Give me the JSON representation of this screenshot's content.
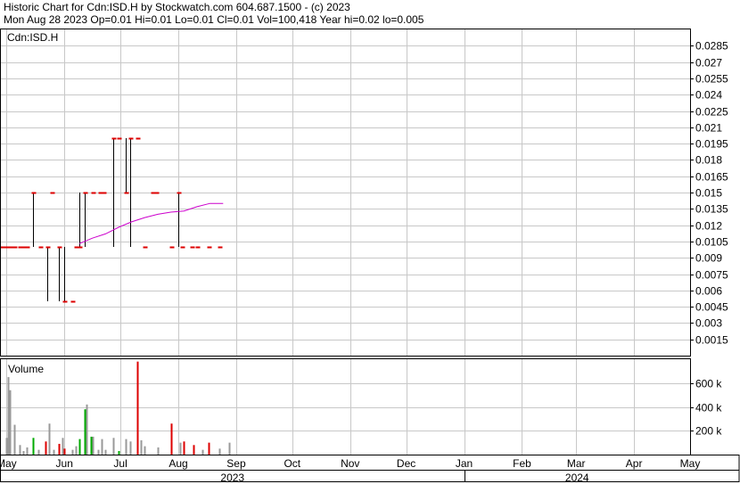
{
  "header": {
    "line1": "Historic Chart for Cdn:ISD.H by Stockwatch.com 604.687.1500 - (c) 2023",
    "line2": "Mon Aug 28 2023  Op=0.01  Hi=0.01  Lo=0.01  Cl=0.01  Vol=100,418  Year hi=0.02  lo=0.005"
  },
  "chart_data": [
    {
      "type": "ohlc",
      "label": "Cdn:ISD.H",
      "price_axis_labels": [
        "0.0285",
        "0.027",
        "0.0255",
        "0.024",
        "0.0225",
        "0.021",
        "0.0195",
        "0.018",
        "0.0165",
        "0.015",
        "0.0135",
        "0.012",
        "0.0105",
        "0.009",
        "0.0075",
        "0.006",
        "0.0045",
        "0.003",
        "0.0015"
      ],
      "ylim": [
        0,
        0.03
      ],
      "grid": true,
      "colors": {
        "bar": "#000000",
        "close_tick": "#dd0000",
        "moving_average": "#cc00cc",
        "grid": "#c8c8c8"
      },
      "bars": [
        {
          "date": "2023-05-01",
          "high": 0.01,
          "low": 0.01,
          "close": 0.01
        },
        {
          "date": "2023-05-03",
          "high": 0.01,
          "low": 0.01,
          "close": 0.01
        },
        {
          "date": "2023-05-05",
          "high": 0.01,
          "low": 0.01,
          "close": 0.01
        },
        {
          "date": "2023-05-08",
          "high": 0.01,
          "low": 0.01,
          "close": 0.01
        },
        {
          "date": "2023-05-10",
          "high": 0.01,
          "low": 0.01,
          "close": 0.01
        },
        {
          "date": "2023-05-12",
          "high": 0.01,
          "low": 0.01,
          "close": 0.01
        },
        {
          "date": "2023-05-15",
          "high": 0.015,
          "low": 0.01,
          "close": 0.015
        },
        {
          "date": "2023-05-19",
          "high": 0.01,
          "low": 0.01,
          "close": 0.01
        },
        {
          "date": "2023-05-23",
          "high": 0.01,
          "low": 0.005,
          "close": 0.01
        },
        {
          "date": "2023-05-25",
          "high": 0.015,
          "low": 0.015,
          "close": 0.015
        },
        {
          "date": "2023-05-29",
          "high": 0.01,
          "low": 0.005,
          "close": 0.01
        },
        {
          "date": "2023-06-01",
          "high": 0.01,
          "low": 0.005,
          "close": 0.005
        },
        {
          "date": "2023-06-05",
          "high": 0.005,
          "low": 0.005,
          "close": 0.005
        },
        {
          "date": "2023-06-07",
          "high": 0.01,
          "low": 0.01,
          "close": 0.01
        },
        {
          "date": "2023-06-09",
          "high": 0.015,
          "low": 0.01,
          "close": 0.01
        },
        {
          "date": "2023-06-12",
          "high": 0.015,
          "low": 0.01,
          "close": 0.015
        },
        {
          "date": "2023-06-16",
          "high": 0.015,
          "low": 0.015,
          "close": 0.015
        },
        {
          "date": "2023-06-20",
          "high": 0.015,
          "low": 0.015,
          "close": 0.015
        },
        {
          "date": "2023-06-22",
          "high": 0.015,
          "low": 0.015,
          "close": 0.015
        },
        {
          "date": "2023-06-27",
          "high": 0.02,
          "low": 0.01,
          "close": 0.02
        },
        {
          "date": "2023-06-30",
          "high": 0.02,
          "low": 0.02,
          "close": 0.02
        },
        {
          "date": "2023-07-04",
          "high": 0.02,
          "low": 0.015,
          "close": 0.015
        },
        {
          "date": "2023-07-06",
          "high": 0.02,
          "low": 0.01,
          "close": 0.02
        },
        {
          "date": "2023-07-10",
          "high": 0.02,
          "low": 0.02,
          "close": 0.02
        },
        {
          "date": "2023-07-14",
          "high": 0.01,
          "low": 0.01,
          "close": 0.01
        },
        {
          "date": "2023-07-18",
          "high": 0.015,
          "low": 0.015,
          "close": 0.015
        },
        {
          "date": "2023-07-20",
          "high": 0.015,
          "low": 0.015,
          "close": 0.015
        },
        {
          "date": "2023-07-28",
          "high": 0.01,
          "low": 0.01,
          "close": 0.01
        },
        {
          "date": "2023-08-01",
          "high": 0.015,
          "low": 0.01,
          "close": 0.015
        },
        {
          "date": "2023-08-03",
          "high": 0.01,
          "low": 0.01,
          "close": 0.01
        },
        {
          "date": "2023-08-08",
          "high": 0.01,
          "low": 0.01,
          "close": 0.01
        },
        {
          "date": "2023-08-11",
          "high": 0.01,
          "low": 0.01,
          "close": 0.01
        },
        {
          "date": "2023-08-17",
          "high": 0.01,
          "low": 0.01,
          "close": 0.01
        },
        {
          "date": "2023-08-23",
          "high": 0.01,
          "low": 0.01,
          "close": 0.01
        }
      ],
      "moving_average": [
        {
          "date": "2023-06-09",
          "value": 0.0103
        },
        {
          "date": "2023-06-16",
          "value": 0.0108
        },
        {
          "date": "2023-06-23",
          "value": 0.0112
        },
        {
          "date": "2023-06-30",
          "value": 0.0118
        },
        {
          "date": "2023-07-07",
          "value": 0.0123
        },
        {
          "date": "2023-07-14",
          "value": 0.0127
        },
        {
          "date": "2023-07-21",
          "value": 0.013
        },
        {
          "date": "2023-07-28",
          "value": 0.0132
        },
        {
          "date": "2023-08-04",
          "value": 0.0133
        },
        {
          "date": "2023-08-11",
          "value": 0.0137
        },
        {
          "date": "2023-08-18",
          "value": 0.014
        },
        {
          "date": "2023-08-25",
          "value": 0.014
        }
      ]
    },
    {
      "type": "bar",
      "label": "Volume",
      "volume_axis_labels": [
        "600 k",
        "400 k",
        "200 k"
      ],
      "ylim": [
        0,
        800000
      ],
      "colors": {
        "up": "#00aa00",
        "down": "#dd0000",
        "unchanged": "#999999"
      },
      "bars": [
        {
          "date": "2023-05-01",
          "volume": 140000,
          "dir": "unchanged"
        },
        {
          "date": "2023-05-02",
          "volume": 650000,
          "dir": "unchanged"
        },
        {
          "date": "2023-05-03",
          "volume": 540000,
          "dir": "unchanged"
        },
        {
          "date": "2023-05-05",
          "volume": 250000,
          "dir": "unchanged"
        },
        {
          "date": "2023-05-08",
          "volume": 80000,
          "dir": "unchanged"
        },
        {
          "date": "2023-05-10",
          "volume": 30000,
          "dir": "unchanged"
        },
        {
          "date": "2023-05-12",
          "volume": 60000,
          "dir": "unchanged"
        },
        {
          "date": "2023-05-15",
          "volume": 140000,
          "dir": "up"
        },
        {
          "date": "2023-05-18",
          "volume": 40000,
          "dir": "unchanged"
        },
        {
          "date": "2023-05-22",
          "volume": 110000,
          "dir": "down"
        },
        {
          "date": "2023-05-24",
          "volume": 260000,
          "dir": "unchanged"
        },
        {
          "date": "2023-05-26",
          "volume": 40000,
          "dir": "unchanged"
        },
        {
          "date": "2023-05-29",
          "volume": 90000,
          "dir": "down"
        },
        {
          "date": "2023-05-31",
          "volume": 140000,
          "dir": "unchanged"
        },
        {
          "date": "2023-06-01",
          "volume": 50000,
          "dir": "down"
        },
        {
          "date": "2023-06-05",
          "volume": 40000,
          "dir": "unchanged"
        },
        {
          "date": "2023-06-07",
          "volume": 70000,
          "dir": "unchanged"
        },
        {
          "date": "2023-06-09",
          "volume": 130000,
          "dir": "up"
        },
        {
          "date": "2023-06-12",
          "volume": 380000,
          "dir": "up"
        },
        {
          "date": "2023-06-13",
          "volume": 420000,
          "dir": "unchanged"
        },
        {
          "date": "2023-06-15",
          "volume": 150000,
          "dir": "up"
        },
        {
          "date": "2023-06-16",
          "volume": 150000,
          "dir": "unchanged"
        },
        {
          "date": "2023-06-19",
          "volume": 40000,
          "dir": "unchanged"
        },
        {
          "date": "2023-06-21",
          "volume": 130000,
          "dir": "unchanged"
        },
        {
          "date": "2023-06-23",
          "volume": 40000,
          "dir": "unchanged"
        },
        {
          "date": "2023-06-27",
          "volume": 140000,
          "dir": "unchanged"
        },
        {
          "date": "2023-06-30",
          "volume": 30000,
          "dir": "up"
        },
        {
          "date": "2023-07-04",
          "volume": 130000,
          "dir": "unchanged"
        },
        {
          "date": "2023-07-06",
          "volume": 110000,
          "dir": "unchanged"
        },
        {
          "date": "2023-07-10",
          "volume": 780000,
          "dir": "down"
        },
        {
          "date": "2023-07-12",
          "volume": 120000,
          "dir": "unchanged"
        },
        {
          "date": "2023-07-14",
          "volume": 70000,
          "dir": "unchanged"
        },
        {
          "date": "2023-07-21",
          "volume": 60000,
          "dir": "unchanged"
        },
        {
          "date": "2023-07-28",
          "volume": 260000,
          "dir": "down"
        },
        {
          "date": "2023-08-02",
          "volume": 100000,
          "dir": "unchanged"
        },
        {
          "date": "2023-08-04",
          "volume": 110000,
          "dir": "down"
        },
        {
          "date": "2023-08-09",
          "volume": 80000,
          "dir": "down"
        },
        {
          "date": "2023-08-14",
          "volume": 40000,
          "dir": "unchanged"
        },
        {
          "date": "2023-08-17",
          "volume": 100000,
          "dir": "down"
        },
        {
          "date": "2023-08-23",
          "volume": 50000,
          "dir": "unchanged"
        },
        {
          "date": "2023-08-28",
          "volume": 100000,
          "dir": "unchanged"
        }
      ]
    }
  ],
  "time_axis": {
    "months": [
      "May",
      "Jun",
      "Jul",
      "Aug",
      "Sep",
      "Oct",
      "Nov",
      "Dec",
      "Jan",
      "Feb",
      "Mar",
      "Apr",
      "May"
    ],
    "month_dates": [
      "2023-05-01",
      "2023-06-01",
      "2023-07-01",
      "2023-08-01",
      "2023-09-01",
      "2023-10-01",
      "2023-11-01",
      "2023-12-01",
      "2024-01-01",
      "2024-02-01",
      "2024-03-01",
      "2024-04-01",
      "2024-05-01"
    ],
    "years": [
      "2023",
      "2024"
    ],
    "range": [
      "2023-04-28",
      "2024-05-01"
    ]
  }
}
